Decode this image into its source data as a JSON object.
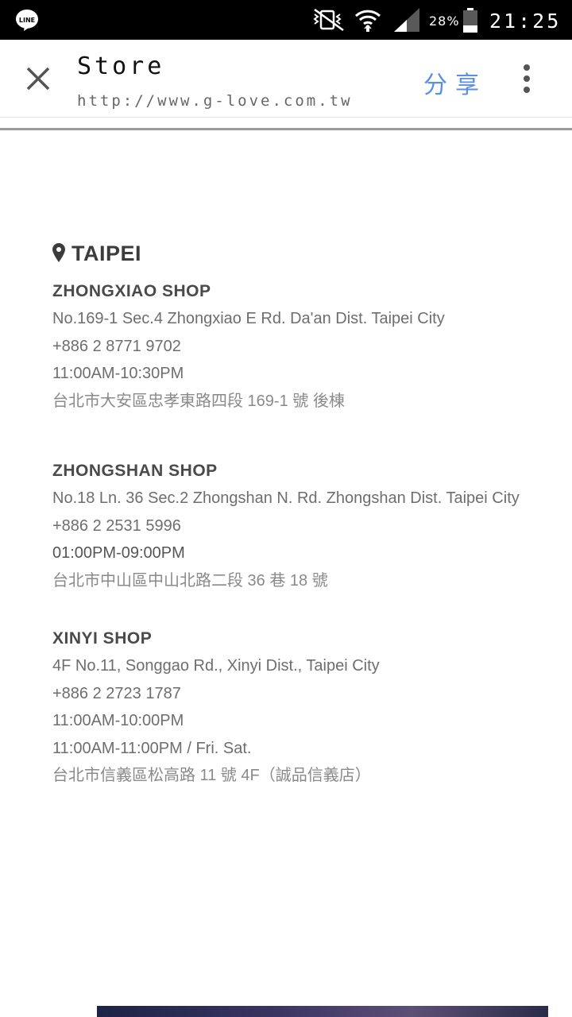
{
  "status_bar": {
    "app_notification_icon": "line-app-icon",
    "battery_percent": "28%",
    "time": "21:25"
  },
  "toolbar": {
    "title": "Store",
    "url": "http://www.g-love.com.tw",
    "share_label": "分享"
  },
  "city": {
    "name": "TAIPEI"
  },
  "shops": [
    {
      "name": "ZHONGXIAO SHOP",
      "lines": [
        "No.169-1 Sec.4 Zhongxiao E Rd. Da'an Dist. Taipei City",
        "+886 2 8771 9702",
        "11:00AM-10:30PM",
        "台北市大安區忠孝東路四段 169-1 號 後棟"
      ]
    },
    {
      "name": "ZHONGSHAN SHOP",
      "lines": [
        "No.18 Ln. 36 Sec.2 Zhongshan N. Rd. Zhongshan Dist. Taipei City",
        "+886 2 2531 5996",
        "01:00PM-09:00PM",
        "台北市中山區中山北路二段 36 巷 18 號"
      ]
    },
    {
      "name": "XINYI SHOP",
      "lines": [
        "4F No.11, Songgao Rd., Xinyi Dist., Taipei City",
        "+886  2 2723 1787",
        "11:00AM-10:00PM",
        "11:00AM-11:00PM / Fri. Sat.",
        "台北市信義區松高路 11 號 4F（誠品信義店）"
      ]
    }
  ]
}
